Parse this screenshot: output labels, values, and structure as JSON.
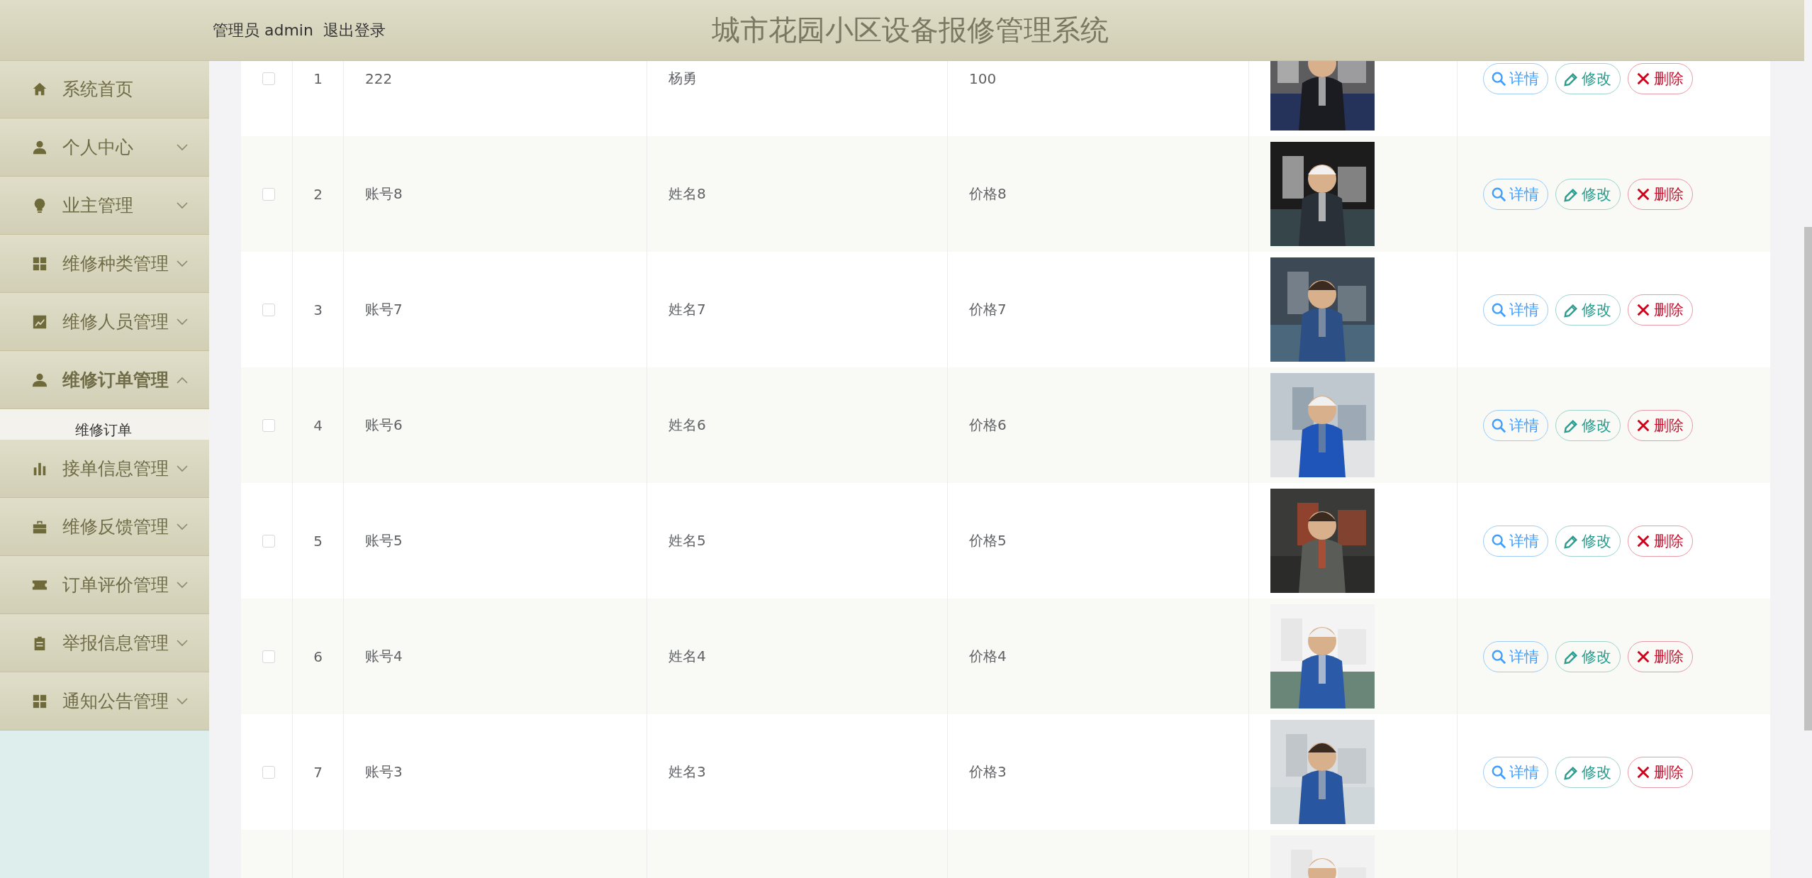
{
  "header": {
    "user_label": "管理员 admin",
    "logout": "退出登录",
    "title": "城市花园小区设备报修管理系统"
  },
  "sidebar": {
    "items": [
      {
        "label": "系统首页",
        "kind": "link"
      },
      {
        "label": "个人中心",
        "kind": "menu",
        "expanded": false
      },
      {
        "label": "业主管理",
        "kind": "menu",
        "expanded": false
      },
      {
        "label": "维修种类管理",
        "kind": "menu",
        "expanded": false
      },
      {
        "label": "维修人员管理",
        "kind": "menu",
        "expanded": false
      },
      {
        "label": "维修订单管理",
        "kind": "menu",
        "expanded": true,
        "children": [
          {
            "label": "维修订单",
            "selected": true
          }
        ]
      },
      {
        "label": "接单信息管理",
        "kind": "menu",
        "expanded": false
      },
      {
        "label": "维修反馈管理",
        "kind": "menu",
        "expanded": false
      },
      {
        "label": "订单评价管理",
        "kind": "menu",
        "expanded": false
      },
      {
        "label": "举报信息管理",
        "kind": "menu",
        "expanded": false
      },
      {
        "label": "通知公告管理",
        "kind": "menu",
        "expanded": false
      }
    ]
  },
  "table": {
    "rows": [
      {
        "checked": false,
        "index": "1",
        "account": "222",
        "name": "杨勇",
        "price": "100",
        "photo": {
          "kind": "picture"
        },
        "actions": [
          {
            "label": "详情",
            "kind": "detail"
          },
          {
            "label": "修改",
            "kind": "edit"
          },
          {
            "label": "删除",
            "kind": "delete"
          }
        ]
      },
      {
        "checked": false,
        "index": "2",
        "account": "账号8",
        "name": "姓名8",
        "price": "价格8",
        "photo": {
          "kind": "picture"
        },
        "actions": [
          {
            "label": "详情",
            "kind": "detail"
          },
          {
            "label": "修改",
            "kind": "edit"
          },
          {
            "label": "删除",
            "kind": "delete"
          }
        ]
      },
      {
        "checked": false,
        "index": "3",
        "account": "账号7",
        "name": "姓名7",
        "price": "价格7",
        "photo": {
          "kind": "picture"
        },
        "actions": [
          {
            "label": "详情",
            "kind": "detail"
          },
          {
            "label": "修改",
            "kind": "edit"
          },
          {
            "label": "删除",
            "kind": "delete"
          }
        ]
      },
      {
        "checked": false,
        "index": "4",
        "account": "账号6",
        "name": "姓名6",
        "price": "价格6",
        "photo": {
          "kind": "picture"
        },
        "actions": [
          {
            "label": "详情",
            "kind": "detail"
          },
          {
            "label": "修改",
            "kind": "edit"
          },
          {
            "label": "删除",
            "kind": "delete"
          }
        ]
      },
      {
        "checked": false,
        "index": "5",
        "account": "账号5",
        "name": "姓名5",
        "price": "价格5",
        "photo": {
          "kind": "picture"
        },
        "actions": [
          {
            "label": "详情",
            "kind": "detail"
          },
          {
            "label": "修改",
            "kind": "edit"
          },
          {
            "label": "删除",
            "kind": "delete"
          }
        ]
      },
      {
        "checked": false,
        "index": "6",
        "account": "账号4",
        "name": "姓名4",
        "price": "价格4",
        "photo": {
          "kind": "picture"
        },
        "actions": [
          {
            "label": "详情",
            "kind": "detail"
          },
          {
            "label": "修改",
            "kind": "edit"
          },
          {
            "label": "删除",
            "kind": "delete"
          }
        ]
      },
      {
        "checked": false,
        "index": "7",
        "account": "账号3",
        "name": "姓名3",
        "price": "价格3",
        "photo": {
          "kind": "picture"
        },
        "actions": [
          {
            "label": "详情",
            "kind": "detail"
          },
          {
            "label": "修改",
            "kind": "edit"
          },
          {
            "label": "删除",
            "kind": "delete"
          }
        ]
      },
      {
        "photo": {
          "kind": "picture"
        }
      }
    ]
  }
}
